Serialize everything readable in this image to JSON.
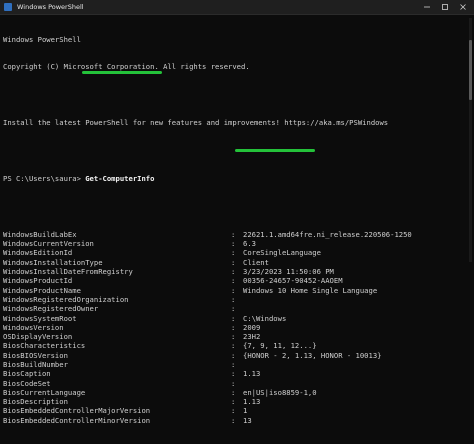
{
  "window": {
    "title": "Windows PowerShell"
  },
  "console": {
    "header": [
      "Windows PowerShell",
      "Copyright (C) Microsoft Corporation. All rights reserved.",
      "",
      "Install the latest PowerShell for new features and improvements! https://aka.ms/PSWindows",
      ""
    ],
    "prompt": "PS C:\\Users\\saura> ",
    "command": "Get-ComputerInfo",
    "properties": [
      {
        "name": "WindowsBuildLabEx",
        "value": "22621.1.amd64fre.ni_release.220506-1250"
      },
      {
        "name": "WindowsCurrentVersion",
        "value": "6.3"
      },
      {
        "name": "WindowsEditionId",
        "value": "CoreSingleLanguage"
      },
      {
        "name": "WindowsInstallationType",
        "value": "Client"
      },
      {
        "name": "WindowsInstallDateFromRegistry",
        "value": "3/23/2023 11:50:06 PM"
      },
      {
        "name": "WindowsProductId",
        "value": "00356-24657-90452-AAOEM"
      },
      {
        "name": "WindowsProductName",
        "value": "Windows 10 Home Single Language"
      },
      {
        "name": "WindowsRegisteredOrganization",
        "value": ""
      },
      {
        "name": "WindowsRegisteredOwner",
        "value": ""
      },
      {
        "name": "WindowsSystemRoot",
        "value": "C:\\Windows"
      },
      {
        "name": "WindowsVersion",
        "value": "2009"
      },
      {
        "name": "OSDisplayVersion",
        "value": "23H2"
      },
      {
        "name": "BiosCharacteristics",
        "value": "{7, 9, 11, 12...}"
      },
      {
        "name": "BiosBIOSVersion",
        "value": "{HONOR - 2, 1.13, HONOR - 10013}"
      },
      {
        "name": "BiosBuildNumber",
        "value": ""
      },
      {
        "name": "BiosCaption",
        "value": "1.13"
      },
      {
        "name": "BiosCodeSet",
        "value": ""
      },
      {
        "name": "BiosCurrentLanguage",
        "value": "en|US|iso8859-1,0"
      },
      {
        "name": "BiosDescription",
        "value": "1.13"
      },
      {
        "name": "BiosEmbeddedControllerMajorVersion",
        "value": "1"
      },
      {
        "name": "BiosEmbeddedControllerMinorVersion",
        "value": "13"
      }
    ]
  },
  "colors": {
    "background": "#0c0c0c",
    "text": "#d0d0d0",
    "highlight": "#24c23a"
  }
}
